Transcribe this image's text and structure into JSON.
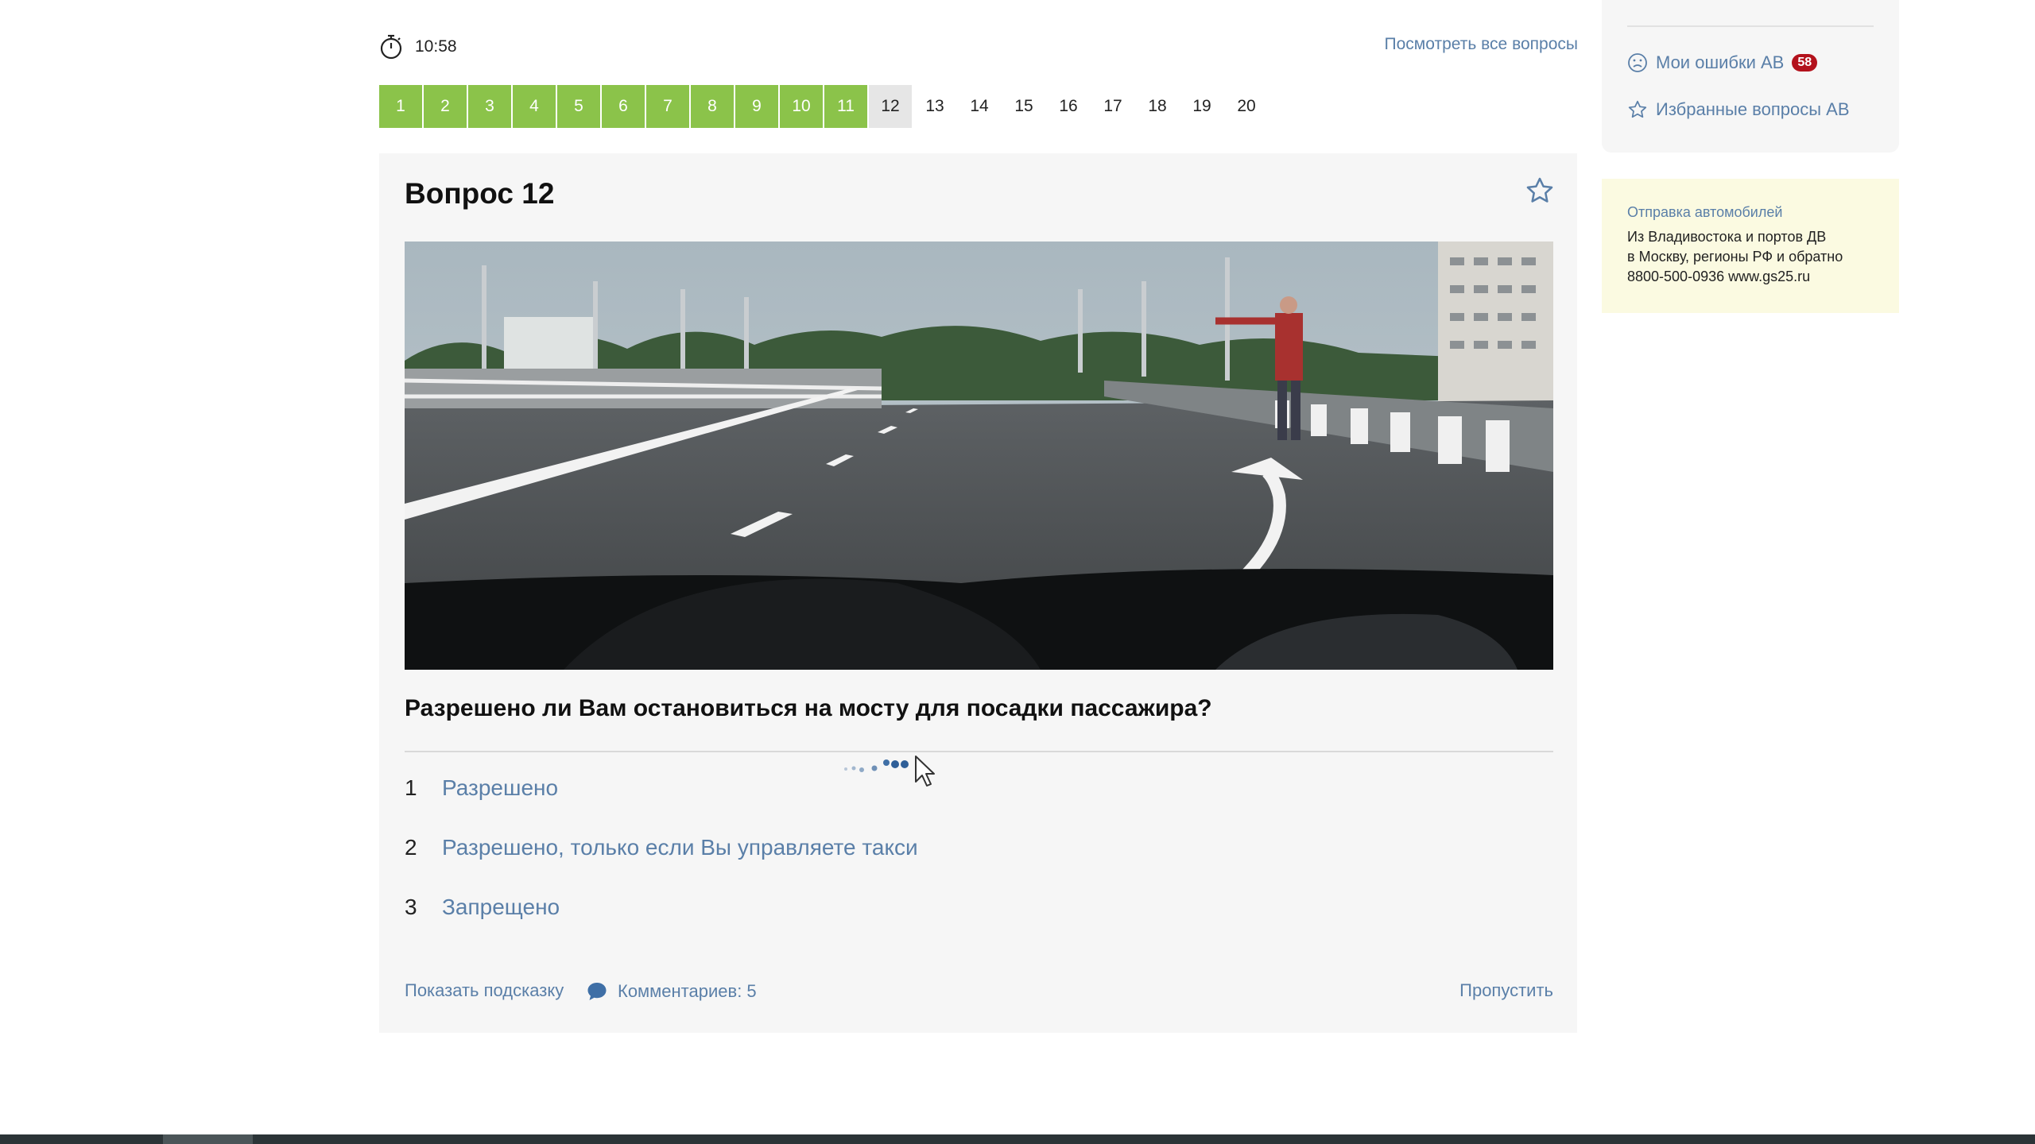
{
  "timer": {
    "time": "10:58",
    "see_all": "Посмотреть все вопросы"
  },
  "nav": {
    "questions": [
      {
        "n": "1",
        "state": "done"
      },
      {
        "n": "2",
        "state": "done"
      },
      {
        "n": "3",
        "state": "done"
      },
      {
        "n": "4",
        "state": "done"
      },
      {
        "n": "5",
        "state": "done"
      },
      {
        "n": "6",
        "state": "done"
      },
      {
        "n": "7",
        "state": "done"
      },
      {
        "n": "8",
        "state": "done"
      },
      {
        "n": "9",
        "state": "done"
      },
      {
        "n": "10",
        "state": "done"
      },
      {
        "n": "11",
        "state": "done"
      },
      {
        "n": "12",
        "state": "current"
      },
      {
        "n": "13",
        "state": "todo"
      },
      {
        "n": "14",
        "state": "todo"
      },
      {
        "n": "15",
        "state": "todo"
      },
      {
        "n": "16",
        "state": "todo"
      },
      {
        "n": "17",
        "state": "todo"
      },
      {
        "n": "18",
        "state": "todo"
      },
      {
        "n": "19",
        "state": "todo"
      },
      {
        "n": "20",
        "state": "todo"
      }
    ]
  },
  "card": {
    "title": "Вопрос 12",
    "question": "Разрешено ли Вам остановиться на мосту для посадки пассажира?",
    "answers": [
      {
        "num": "1",
        "text": "Разрешено"
      },
      {
        "num": "2",
        "text": "Разрешено, только если Вы управляете такси"
      },
      {
        "num": "3",
        "text": "Запрещено"
      }
    ],
    "hint": "Показать подсказку",
    "comments": "Комментариев: 5",
    "skip": "Пропустить"
  },
  "sidebar": {
    "errors_label": "Мои ошибки АВ",
    "errors_count": "58",
    "favorites_label": "Избранные вопросы АВ"
  },
  "ad": {
    "title": "Отправка автомобилей",
    "lines": [
      "Из Владивостока и портов ДВ",
      "в Москву, регионы РФ и обратно",
      "8800-500-0936 www.gs25.ru"
    ]
  },
  "colors": {
    "accent_link": "#5a7fa8",
    "done_green": "#8bc34a",
    "badge_red": "#b3121c",
    "ad_bg": "#fbfae1"
  }
}
